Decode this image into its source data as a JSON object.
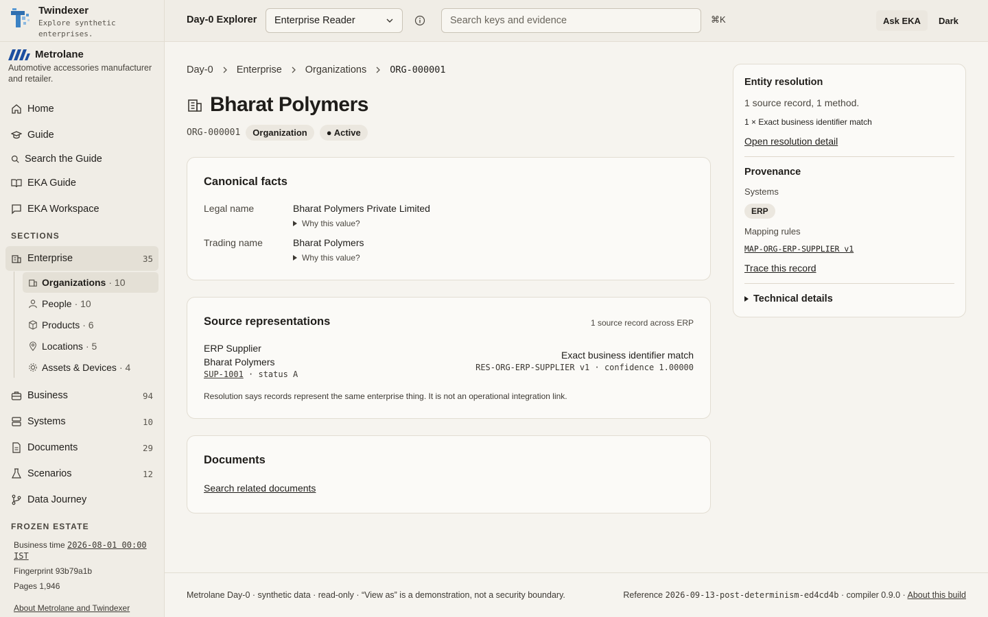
{
  "brand": {
    "name": "Twindexer",
    "tagline": "Explore synthetic enterprises."
  },
  "org": {
    "name": "Metrolane",
    "description": "Automotive accessories manufacturer and retailer."
  },
  "nav": {
    "home": "Home",
    "guide": "Guide",
    "search_guide": "Search the Guide",
    "eka_guide": "EKA Guide",
    "eka_workspace": "EKA Workspace",
    "sections_label": "SECTIONS",
    "enterprise": {
      "label": "Enterprise",
      "count": "35"
    },
    "sub": [
      {
        "label": "Organizations",
        "count": "· 10"
      },
      {
        "label": "People",
        "count": "· 10"
      },
      {
        "label": "Products",
        "count": "· 6"
      },
      {
        "label": "Locations",
        "count": "· 5"
      },
      {
        "label": "Assets & Devices",
        "count": "· 4"
      }
    ],
    "business": {
      "label": "Business",
      "count": "94"
    },
    "systems": {
      "label": "Systems",
      "count": "10"
    },
    "documents": {
      "label": "Documents",
      "count": "29"
    },
    "scenarios": {
      "label": "Scenarios",
      "count": "12"
    },
    "data_journey": "Data Journey"
  },
  "frozen": {
    "label": "FROZEN ESTATE",
    "business_time_label": "Business time",
    "business_time": "2026-08-01 00:00 IST",
    "fingerprint": "Fingerprint 93b79a1b",
    "pages": "Pages 1,946",
    "about": "About Metrolane and Twindexer"
  },
  "header": {
    "app_name": "Day-0 Explorer",
    "role_select": "Enterprise Reader",
    "search_placeholder": "Search keys and evidence",
    "shortcut": "⌘K",
    "ask": "Ask EKA",
    "theme": "Dark"
  },
  "breadcrumb": [
    "Day-0",
    "Enterprise",
    "Organizations",
    "ORG-000001"
  ],
  "entity": {
    "title": "Bharat Polymers",
    "id": "ORG-000001",
    "type": "Organization",
    "status": "Active"
  },
  "canonical": {
    "heading": "Canonical facts",
    "facts": [
      {
        "label": "Legal name",
        "value": "Bharat Polymers Private Limited",
        "why": "Why this value?"
      },
      {
        "label": "Trading name",
        "value": "Bharat Polymers",
        "why": "Why this value?"
      }
    ]
  },
  "sources": {
    "heading": "Source representations",
    "summary": "1 source record across ERP",
    "record": {
      "system": "ERP Supplier",
      "name": "Bharat Polymers",
      "key": "SUP-1001",
      "status": "· status A",
      "method": "Exact business identifier match",
      "rule": "RES-ORG-ERP-SUPPLIER v1 · confidence 1.00000"
    },
    "note": "Resolution says records represent the same enterprise thing. It is not an operational integration link."
  },
  "documents": {
    "heading": "Documents",
    "link": "Search related documents"
  },
  "panel": {
    "resolution_heading": "Entity resolution",
    "resolution_summary": "1 source record, 1 method.",
    "resolution_method": "1 × Exact business identifier match",
    "resolution_link": "Open resolution detail",
    "provenance_heading": "Provenance",
    "systems_label": "Systems",
    "system_badge": "ERP",
    "mapping_label": "Mapping rules",
    "mapping_rule": "MAP-ORG-ERP-SUPPLIER v1",
    "trace_link": "Trace this record",
    "technical": "Technical details"
  },
  "footer": {
    "left": "Metrolane Day-0 · synthetic data · read-only · “View as” is a demonstration, not a security boundary.",
    "reference_label": "Reference",
    "reference": "2026-09-13-post-determinism-ed4cd4b",
    "compiler": "· compiler 0.9.0 ·",
    "about": "About this build"
  }
}
